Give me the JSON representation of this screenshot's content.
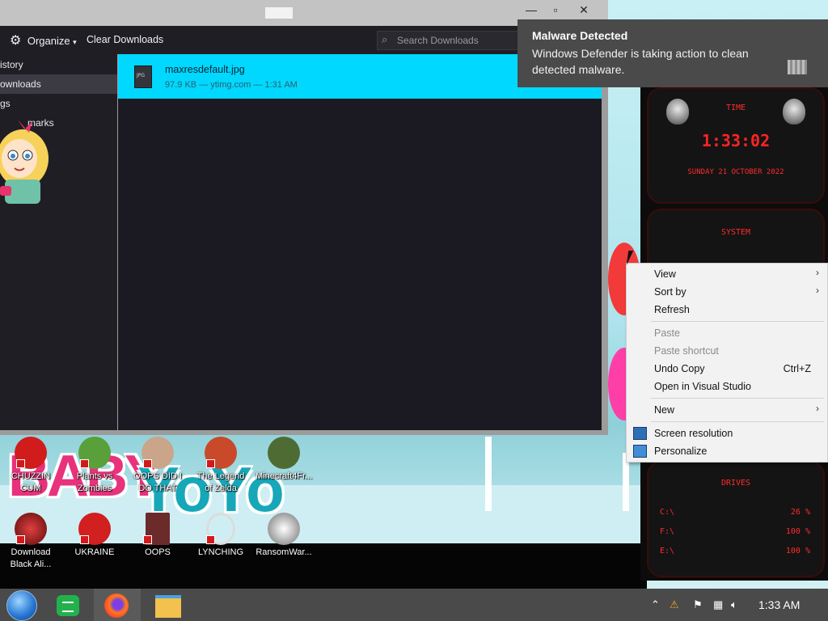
{
  "library": {
    "toolbar": {
      "organize": "Organize",
      "organize_arrow": "▾",
      "clear": "Clear Downloads"
    },
    "search": {
      "placeholder": "Search Downloads"
    },
    "sidebar": [
      {
        "label": "istory"
      },
      {
        "label": "ownloads"
      },
      {
        "label": "gs"
      },
      {
        "label": "marks"
      }
    ],
    "download": {
      "file_name": "maxresdefault.jpg",
      "meta": "97.9 KB — ytimg.com — 1:31 AM",
      "icon_label": "JPG"
    },
    "window_buttons": {
      "minimize": "—",
      "maximize": "▫",
      "close": "✕"
    }
  },
  "notification": {
    "title": "Malware Detected",
    "message": "Windows Defender is taking action to clean detected malware."
  },
  "context_menu": {
    "items": [
      {
        "label": "View",
        "submenu": true
      },
      {
        "label": "Sort by",
        "submenu": true
      },
      {
        "label": "Refresh"
      },
      {
        "label": "Paste",
        "disabled": true
      },
      {
        "label": "Paste shortcut",
        "disabled": true
      },
      {
        "label": "Undo Copy",
        "shortcut": "Ctrl+Z"
      },
      {
        "label": "Open in Visual Studio"
      },
      {
        "label": "New",
        "submenu": true
      },
      {
        "label": "Screen resolution"
      },
      {
        "label": "Personalize"
      }
    ],
    "arrow": "›"
  },
  "gadget": {
    "time_title": "TIME",
    "clock": "1:33:02",
    "date": "SUNDAY 21 OCTOBER 2022",
    "system_title": "SYSTEM",
    "drives_title": "DRIVES",
    "drives": [
      {
        "label": "C:\\",
        "pct": "26 %"
      },
      {
        "label": "F:\\",
        "pct": "100 %"
      },
      {
        "label": "E:\\",
        "pct": "100 %"
      }
    ]
  },
  "desktop": {
    "wallpaper_text_1": "BABY",
    "wallpaper_text_2": "YoYo",
    "icons_row1": [
      {
        "label": "CHUZZIN CUM",
        "color": "#d11c1c"
      },
      {
        "label": "Plants vs Zombies",
        "color": "#5aa03a"
      },
      {
        "label": "OOPS DID I DO THAT",
        "color": "#caa58a"
      },
      {
        "label": "The Legend of Zelda",
        "color": "#c84a2a"
      },
      {
        "label": "Minecraft4Fr...",
        "color": "#4f6b34"
      }
    ],
    "icons_row2": [
      {
        "label": "Download Black Ali...",
        "color": "#b31319"
      },
      {
        "label": "UKRAINE",
        "color": "#d21f1f"
      },
      {
        "label": "OOPS",
        "color": "#6b2b2b"
      },
      {
        "label": "LYNCHING",
        "color": "#dcdcdc"
      },
      {
        "label": "RansomWar...",
        "color": "#e6e6e6"
      }
    ]
  },
  "taskbar": {
    "clock": "1:33 AM",
    "tray_icons": [
      "arrow-up-icon",
      "warning-icon",
      "flag-icon",
      "network-icon",
      "volume-icon"
    ]
  }
}
